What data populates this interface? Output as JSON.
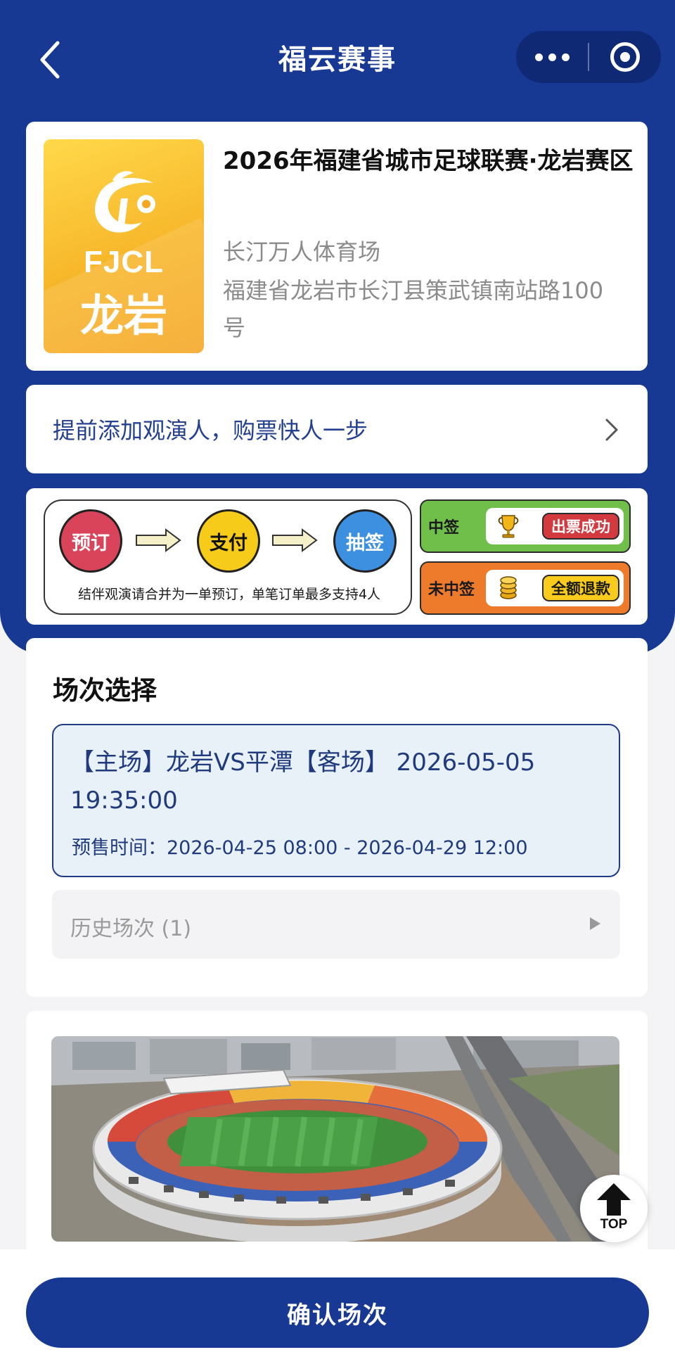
{
  "nav": {
    "title": "福云赛事",
    "back_icon": "chevron-left-icon",
    "more_icon": "more-dots-icon",
    "close_icon": "target-icon"
  },
  "event": {
    "logo": {
      "brand": "FJCL",
      "city": "龙岩"
    },
    "title": "2026年福建省城市足球联赛·龙岩赛区",
    "venue_name": "长汀万人体育场",
    "venue_address": "福建省龙岩市长汀县策武镇南站路100号"
  },
  "viewer": {
    "text": "提前添加观演人，购票快人一步"
  },
  "flow": {
    "steps": [
      "预订",
      "支付",
      "抽签"
    ],
    "note": "结伴观演请合并为一单预订，单笔订单最多支持4人",
    "results": [
      {
        "label": "中签",
        "badge": "出票成功",
        "icon": "trophy-icon"
      },
      {
        "label": "未中签",
        "badge": "全额退款",
        "icon": "coins-icon"
      }
    ]
  },
  "colors": {
    "brand": "#173994",
    "accent_text": "#1f3b7e",
    "session_bg": "#e8f0f8"
  },
  "session": {
    "title": "场次选择",
    "selected": {
      "match": "【主场】龙岩VS平潭【客场】 2026-05-05 19:35:00",
      "presale": "预售时间：2026-04-25 08:00 - 2026-04-29 12:00"
    },
    "history_label": "历史场次 (1)"
  },
  "top_button": {
    "label": "TOP"
  },
  "confirm_label": "确认场次"
}
